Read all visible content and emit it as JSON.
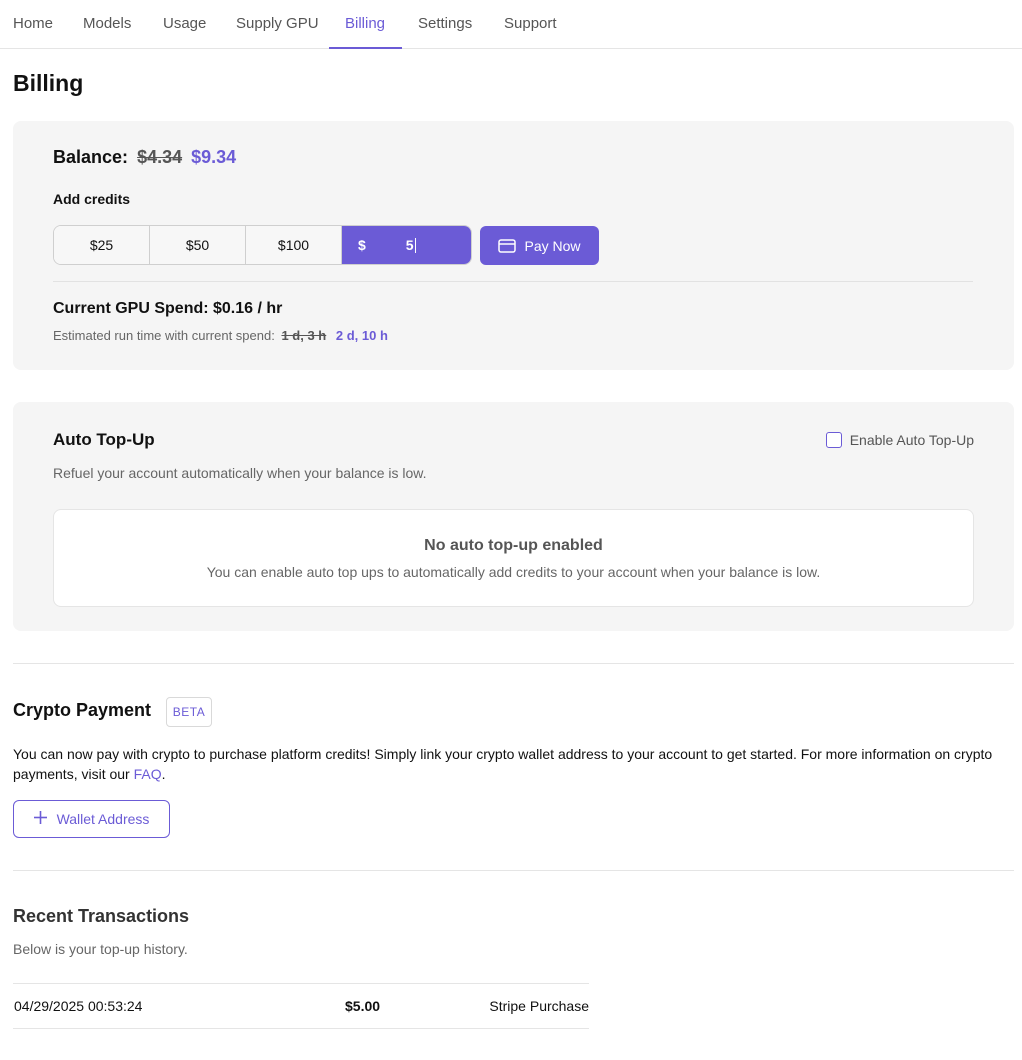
{
  "nav": {
    "tabs": [
      {
        "label": "Home"
      },
      {
        "label": "Models"
      },
      {
        "label": "Usage"
      },
      {
        "label": "Supply GPU"
      },
      {
        "label": "Billing",
        "active": true
      },
      {
        "label": "Settings"
      },
      {
        "label": "Support"
      }
    ]
  },
  "page_title": "Billing",
  "balance": {
    "label": "Balance:",
    "old_value": "$4.34",
    "new_value": "$9.34"
  },
  "add_credits": {
    "label": "Add credits",
    "options": [
      "$25",
      "$50",
      "$100"
    ],
    "custom_prefix": "$",
    "custom_value": "5",
    "pay_button": "Pay Now",
    "pay_icon": "credit-card-icon"
  },
  "gpu_spend": {
    "label": "Current GPU Spend: $0.16 / hr",
    "estimate_label": "Estimated run time with current spend:",
    "old_estimate": "1 d, 3 h",
    "new_estimate": "2 d, 10 h"
  },
  "auto_topup": {
    "title": "Auto Top-Up",
    "checkbox_label": "Enable Auto Top-Up",
    "checked": false,
    "description": "Refuel your account automatically when your balance is low.",
    "empty_title": "No auto top-up enabled",
    "empty_description": "You can enable auto top ups to automatically add credits to your account when your balance is low."
  },
  "crypto": {
    "title": "Crypto Payment",
    "badge": "BETA",
    "description": "You can now pay with crypto to purchase platform credits! Simply link your crypto wallet address to your account to get started. For more information on crypto payments, visit our",
    "faq_link": "FAQ",
    "description_end": ".",
    "wallet_button": "Wallet Address",
    "wallet_icon": "plus-icon"
  },
  "transactions": {
    "title": "Recent Transactions",
    "description": "Below is your top-up history.",
    "rows": [
      {
        "date": "04/29/2025 00:53:24",
        "amount": "$5.00",
        "type": "Stripe Purchase"
      }
    ]
  },
  "colors": {
    "accent": "#6b5bd6",
    "card_bg": "#f5f5f5"
  }
}
